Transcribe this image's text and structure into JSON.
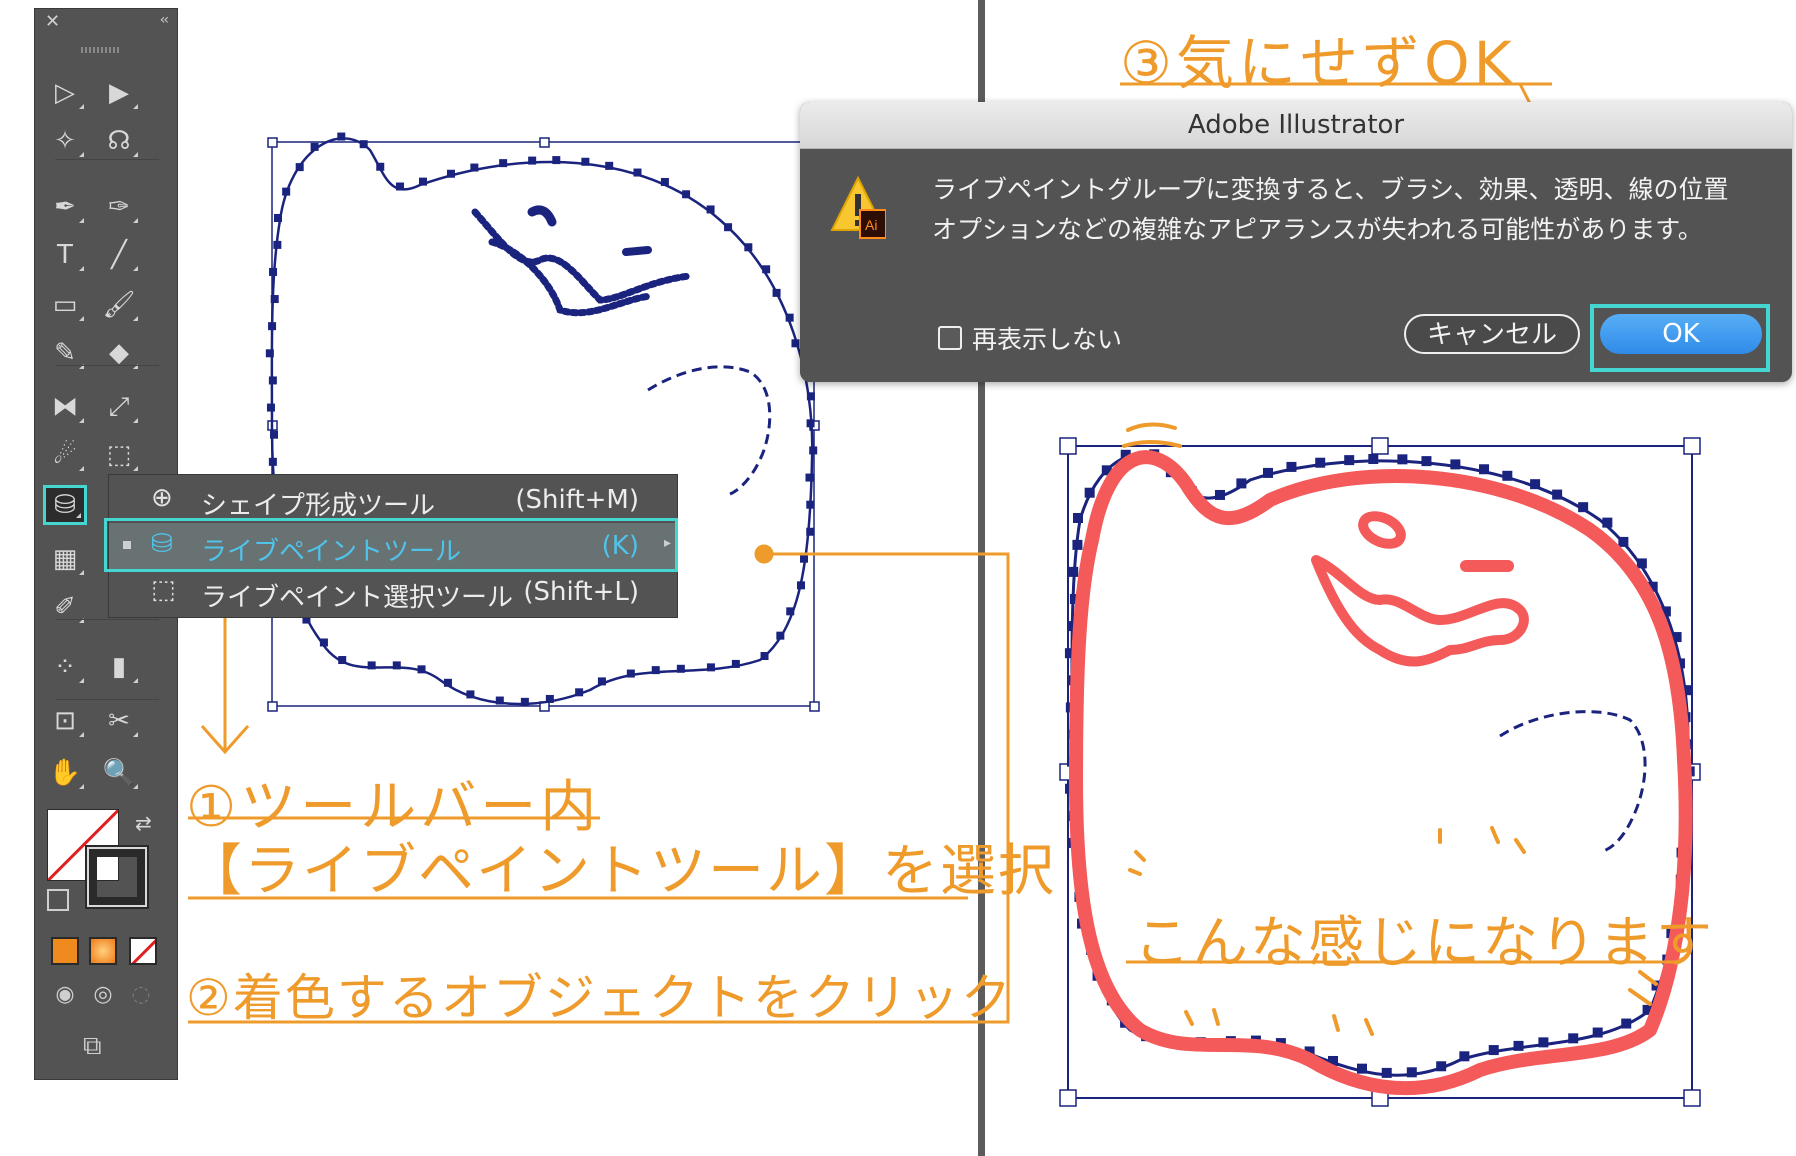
{
  "tool_panel": {
    "close_glyph": "✕",
    "collapse_glyph": "‹‹",
    "tools": [
      {
        "name": "selection-tool-icon",
        "glyph": "▷"
      },
      {
        "name": "direct-selection-tool-icon",
        "glyph": "▶"
      },
      {
        "name": "magic-wand-tool-icon",
        "glyph": "✧"
      },
      {
        "name": "lasso-tool-icon",
        "glyph": "☊"
      },
      {
        "name": "pen-tool-icon",
        "glyph": "✒"
      },
      {
        "name": "curvature-tool-icon",
        "glyph": "✑"
      },
      {
        "name": "type-tool-icon",
        "glyph": "T"
      },
      {
        "name": "line-segment-tool-icon",
        "glyph": "╱"
      },
      {
        "name": "rectangle-tool-icon",
        "glyph": "▭"
      },
      {
        "name": "paintbrush-tool-icon",
        "glyph": "🖌"
      },
      {
        "name": "shaper-tool-icon",
        "glyph": "✎"
      },
      {
        "name": "eraser-tool-icon",
        "glyph": "◆"
      },
      {
        "name": "reflect-tool-icon",
        "glyph": "⧓"
      },
      {
        "name": "scale-tool-icon",
        "glyph": "⤢"
      },
      {
        "name": "warp-tool-icon",
        "glyph": "☄"
      },
      {
        "name": "free-transform-tool-icon",
        "glyph": "⬚"
      },
      {
        "name": "live-paint-bucket-tool-icon",
        "glyph": "⛁"
      },
      {
        "name": "perspective-grid-tool-icon",
        "glyph": "▦"
      },
      {
        "name": "eyedropper-tool-icon",
        "glyph": "✐"
      },
      {
        "name": "symbol-sprayer-tool-icon",
        "glyph": "⁘"
      },
      {
        "name": "column-graph-tool-icon",
        "glyph": "▮"
      },
      {
        "name": "artboard-tool-icon",
        "glyph": "⊡"
      },
      {
        "name": "slice-tool-icon",
        "glyph": "✂"
      },
      {
        "name": "hand-tool-icon",
        "glyph": "✋"
      },
      {
        "name": "zoom-tool-icon",
        "glyph": "🔍"
      }
    ],
    "swap_glyph": "⇄"
  },
  "flyout": {
    "items": [
      {
        "label": "シェイプ形成ツール",
        "shortcut": "(Shift+M)"
      },
      {
        "label": "ライブペイントツール",
        "shortcut": "(K)"
      },
      {
        "label": "ライブペイント選択ツール",
        "shortcut": "(Shift+L)"
      }
    ]
  },
  "dialog": {
    "title": "Adobe Illustrator",
    "message_line1": "ライブペイントグループに変換すると、ブラシ、効果、透明、線の位置",
    "message_line2": "オプションなどの複雑なアピアランスが失われる可能性があります。",
    "checkbox_label": "再表示しない",
    "cancel_label": "キャンセル",
    "ok_label": "OK",
    "badge_text": "Ai"
  },
  "annotations": {
    "step1_line1": "①ツールバー内",
    "step1_line2": "【ライブペイントツール】を選択",
    "step2": "②着色するオブジェクトをクリック",
    "step3": "③気にせずOK",
    "result": "こんな感じになります"
  },
  "colors": {
    "accent_highlight": "#44d6d1",
    "annotation_orange": "#ef9b2c",
    "path_navy": "#1a237e",
    "live_paint_red": "#f45a5a",
    "panel_gray": "#535353",
    "ok_blue": "#2f8be8"
  }
}
